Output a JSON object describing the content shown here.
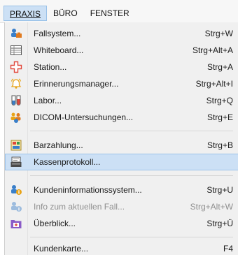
{
  "menubar": {
    "items": [
      {
        "label": "PRAXIS"
      },
      {
        "label": "BÜRO"
      },
      {
        "label": "FENSTER"
      }
    ]
  },
  "menu": {
    "items": [
      {
        "label": "Fallsystem...",
        "shortcut": "Strg+W",
        "icon": "people-case-icon"
      },
      {
        "label": "Whiteboard...",
        "shortcut": "Strg+Alt+A",
        "icon": "whiteboard-icon"
      },
      {
        "label": "Station...",
        "shortcut": "Strg+A",
        "icon": "medical-cross-icon"
      },
      {
        "label": "Erinnerungsmanager...",
        "shortcut": "Strg+Alt+I",
        "icon": "alarm-bell-icon"
      },
      {
        "label": "Labor...",
        "shortcut": "Strg+Q",
        "icon": "test-tube-icon"
      },
      {
        "label": "DICOM-Untersuchungen...",
        "shortcut": "Strg+E",
        "icon": "dicom-people-icon"
      },
      {
        "label": "Barzahlung...",
        "shortcut": "Strg+B",
        "icon": "cash-payment-icon"
      },
      {
        "label": "Kassenprotokoll...",
        "shortcut": "",
        "icon": "cash-register-icon"
      },
      {
        "label": "Kundeninformationssystem...",
        "shortcut": "Strg+U",
        "icon": "customer-info-icon"
      },
      {
        "label": "Info zum aktuellen Fall...",
        "shortcut": "Strg+Alt+W",
        "icon": "case-info-icon"
      },
      {
        "label": "Überblick...",
        "shortcut": "Strg+Ü",
        "icon": "overview-folder-icon"
      },
      {
        "label": "Kundenkarte...",
        "shortcut": "F4",
        "icon": ""
      }
    ]
  },
  "colors": {
    "selection_bg": "#cce0f5",
    "selection_border": "#9cc3ea",
    "menu_bg": "#f0f0f0",
    "disabled_text": "#8f8f8f"
  }
}
